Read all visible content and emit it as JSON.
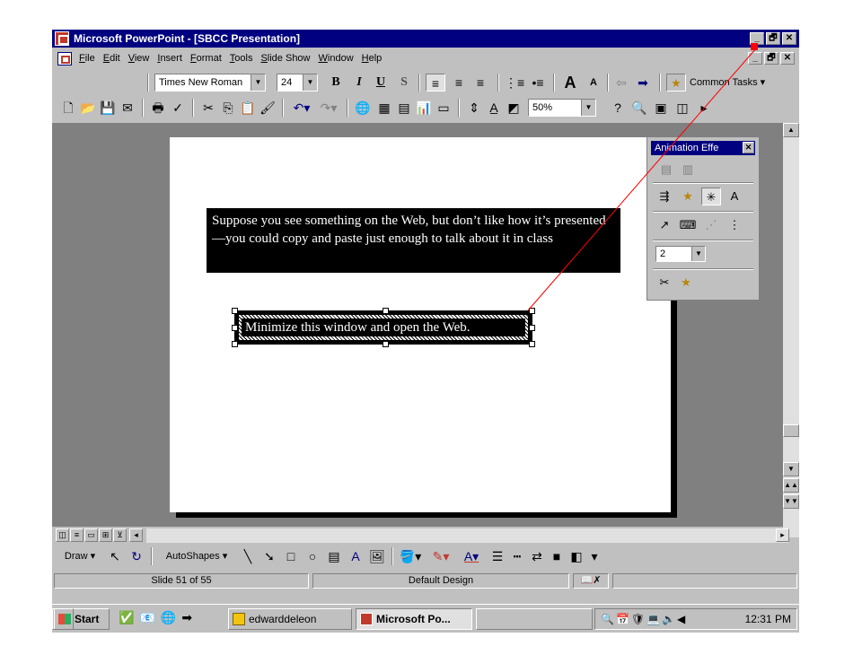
{
  "window": {
    "title": "Microsoft PowerPoint - [SBCC Presentation]",
    "controls": {
      "minimize": "_",
      "maximize": "🗗",
      "close": "✕"
    }
  },
  "menubar": {
    "items": [
      "File",
      "Edit",
      "View",
      "Insert",
      "Format",
      "Tools",
      "Slide Show",
      "Window",
      "Help"
    ]
  },
  "formatting_toolbar": {
    "font_name": "Times New Roman",
    "font_size": "24",
    "bold": "B",
    "italic": "I",
    "underline": "U",
    "shadow": "S",
    "common_tasks": "Common Tasks"
  },
  "standard_toolbar": {
    "zoom": "50%"
  },
  "slide": {
    "textbox1": "Suppose you see something on the Web, but don’t like how it’s presented—you could copy and paste just enough to talk about it in class",
    "textbox2": "Minimize this window and open the Web."
  },
  "animation_panel": {
    "title": "Animation Effe",
    "order_value": "2"
  },
  "drawing_toolbar": {
    "draw": "Draw",
    "autoshapes": "AutoShapes"
  },
  "statusbar": {
    "slide_info": "Slide 51 of 55",
    "design": "Default Design"
  },
  "taskbar": {
    "start": "Start",
    "tasks": [
      "edwarddeleon",
      "Microsoft Po..."
    ],
    "clock": "12:31 PM"
  },
  "colors": {
    "titlebar": "#000080",
    "face": "#c0c0c0",
    "workspace": "#808080",
    "pointer_line": "#ff0000"
  }
}
